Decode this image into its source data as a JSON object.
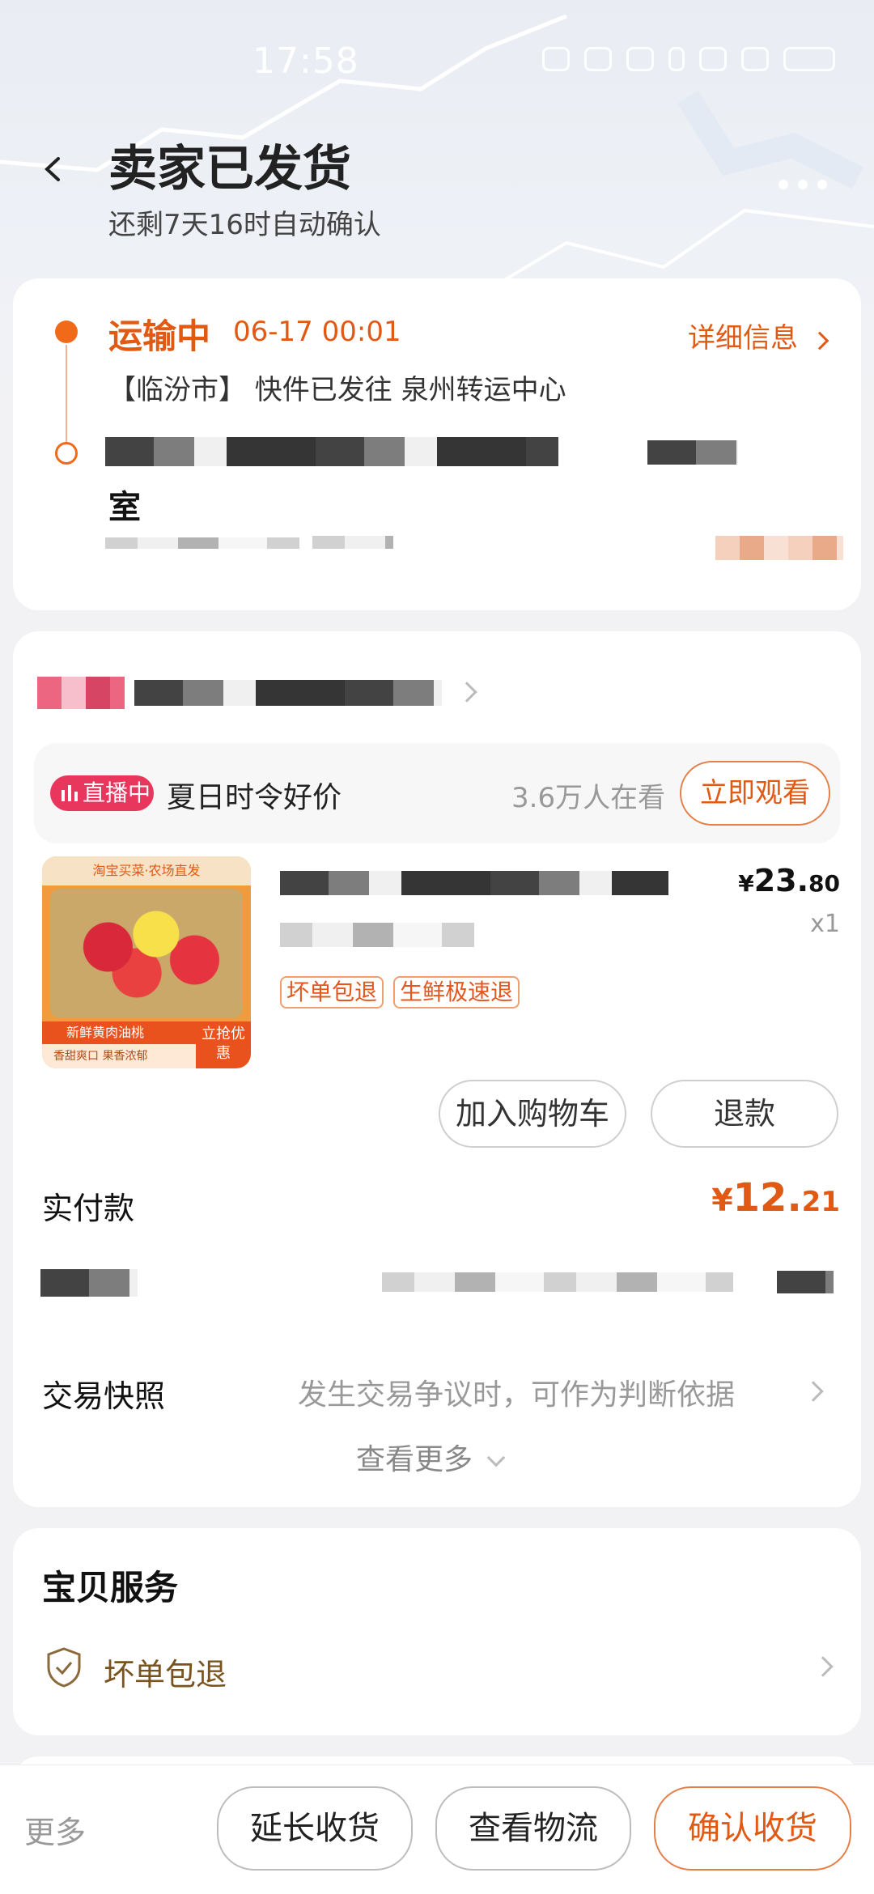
{
  "status_bar": {
    "time": "17:58"
  },
  "header": {
    "title": "卖家已发货",
    "subtitle": "还剩7天16时自动确认"
  },
  "logistics": {
    "status": "运输中",
    "time": "06-17 00:01",
    "detail_link": "详细信息",
    "message": "【临汾市】 快件已发往 泉州转运中心",
    "address_tail": "室"
  },
  "order": {
    "live": {
      "badge": "直播中",
      "title": "夏日时令好价",
      "viewers": "3.6万人在看",
      "watch_button": "立即观看"
    },
    "product": {
      "price_symbol": "¥",
      "price_int": "23.",
      "price_dec": "80",
      "qty": "x1",
      "tags": [
        "坏单包退",
        "生鲜极速退"
      ],
      "thumb_banner": "淘宝买菜·农场直发",
      "thumb_title": "新鲜黄肉油桃",
      "thumb_sub": "香甜爽口 果香浓郁",
      "thumb_cta": "立抢优惠"
    },
    "buttons": {
      "add_cart": "加入购物车",
      "refund": "退款"
    },
    "paid_label": "实付款",
    "paid_symbol": "¥",
    "paid_int": "12.",
    "paid_dec": "21",
    "snapshot_label": "交易快照",
    "snapshot_hint": "发生交易争议时，可作为判断依据",
    "view_more": "查看更多"
  },
  "services": {
    "title": "宝贝服务",
    "item": "坏单包退"
  },
  "bottom_bar": {
    "more": "更多",
    "extend": "延长收货",
    "logistics": "查看物流",
    "confirm": "确认收货"
  },
  "colors": {
    "accent": "#e05a14",
    "live_pink": "#e8365d"
  }
}
